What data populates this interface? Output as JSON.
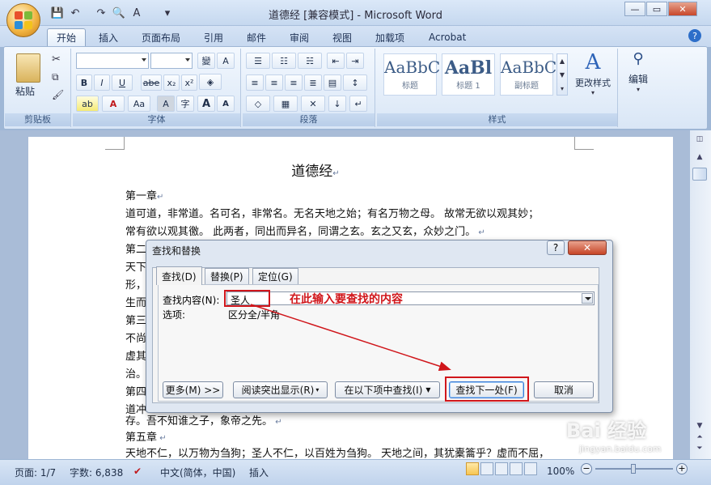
{
  "window": {
    "title": "道德经 [兼容模式] - Microsoft Word",
    "qat_icons": [
      "save-icon",
      "undo-icon",
      "redo-icon",
      "print-preview-icon",
      "spelling-icon",
      "customize-icon"
    ]
  },
  "ribbon": {
    "tabs": [
      "开始",
      "插入",
      "页面布局",
      "引用",
      "邮件",
      "审阅",
      "视图",
      "加载项",
      "Acrobat"
    ],
    "active_tab": "开始",
    "groups": {
      "clipboard": {
        "label": "剪贴板",
        "paste": "粘贴"
      },
      "font": {
        "label": "字体",
        "bold": "B",
        "italic": "I",
        "underline": "U",
        "strike": "abe",
        "sub": "x₂",
        "sup": "x²",
        "grow": "A",
        "shrink": "A",
        "font_color": "A",
        "case": "Aa"
      },
      "paragraph": {
        "label": "段落"
      },
      "styles": {
        "label": "样式",
        "items": [
          {
            "sample": "AaBbC",
            "name": "标题"
          },
          {
            "sample": "AaBl",
            "name": "标题 1"
          },
          {
            "sample": "AaBbC",
            "name": "副标题"
          }
        ],
        "change_styles": "更改样式"
      },
      "editing": {
        "label": "编辑"
      }
    }
  },
  "document": {
    "title": "道德经",
    "lines": [
      "第一章",
      "道可道，非常道。名可名，非常名。无名天地之始；有名万物之母。  故常无欲以观其妙；",
      "常有欲以观其徼。  此两者，同出而异名，同谓之玄。玄之又玄，众妙之门。",
      "第二",
      "天下",
      "形，",
      "生而",
      "第三",
      "不尚",
      "虚其",
      "治。",
      "第四",
      "道冲",
      "存。吾不知谁之子，象帝之先。",
      "第五章",
      "天地不仁，以万物为刍狗；圣人不仁，以百姓为刍狗。  天地之间，其犹橐籥乎？虚而不屈，"
    ]
  },
  "dialog": {
    "title": "查找和替换",
    "help": "?",
    "close": "✕",
    "tabs": [
      "查找(D)",
      "替换(P)",
      "定位(G)"
    ],
    "find_label": "查找内容(N):",
    "find_value": "圣人",
    "options_label": "选项:",
    "options_value": "区分全/半角",
    "buttons": {
      "more": "更多(M) >>",
      "highlight": "阅读突出显示(R)",
      "find_in": "在以下项中查找(I)",
      "find_next": "查找下一处(F)",
      "cancel": "取消"
    }
  },
  "annotation": {
    "text": "在此输入要查找的内容",
    "color": "#d0161b"
  },
  "statusbar": {
    "page": "页面: 1/7",
    "words": "字数: 6,838",
    "language": "中文(简体，中国)",
    "mode": "插入",
    "zoom": "100%"
  },
  "watermark": {
    "text": "Bai 经验",
    "url": "jingyan.baidu.com"
  }
}
